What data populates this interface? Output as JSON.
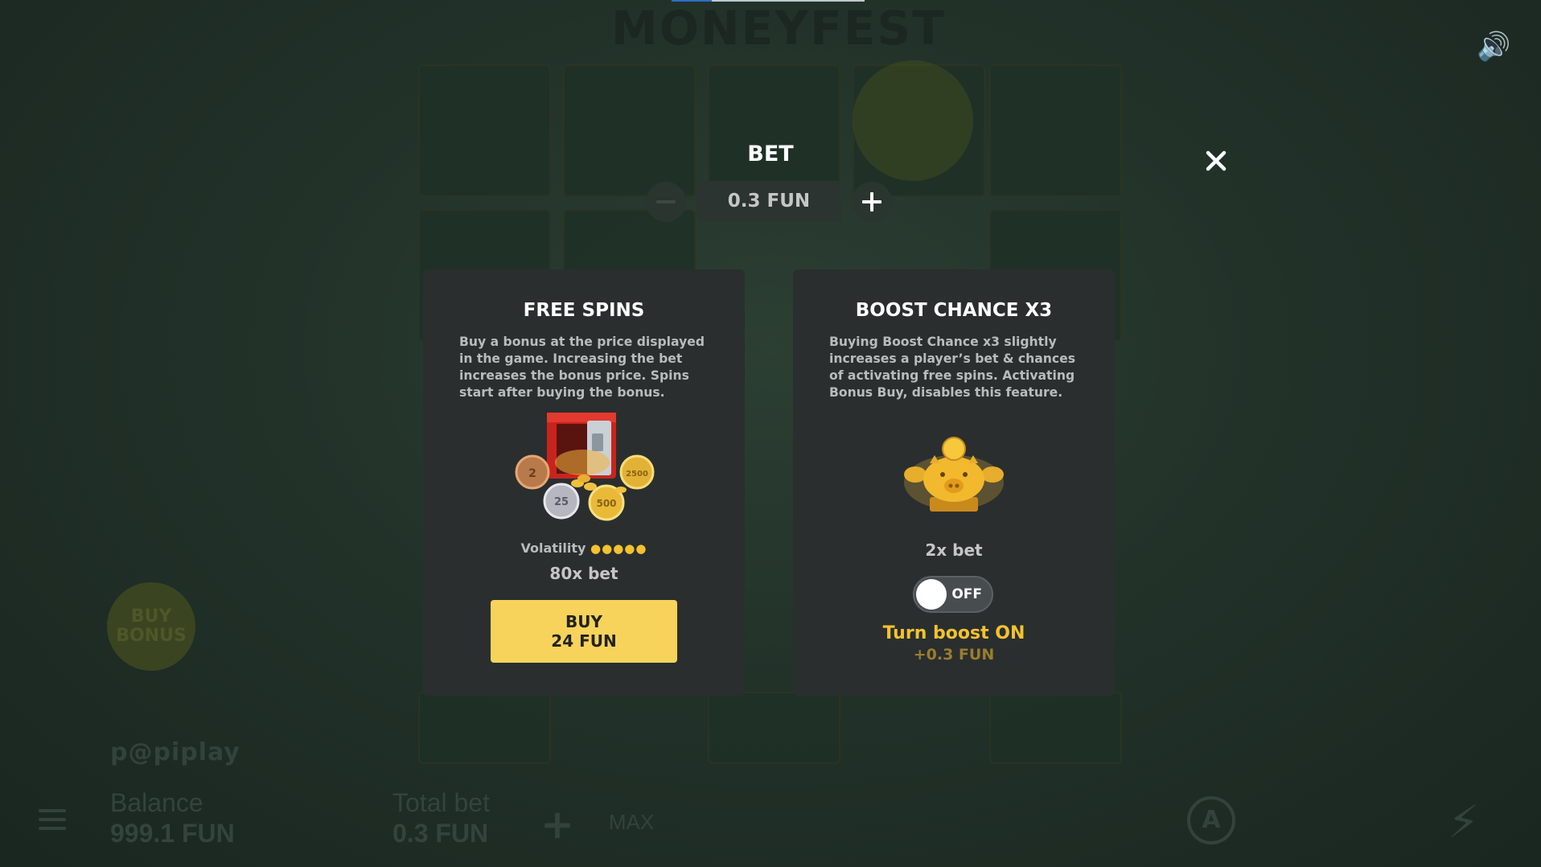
{
  "background": {
    "logo_text": "MONEYFEST",
    "buy_bonus_label": "BUY BONUS",
    "brand": "p@piplay",
    "balance_label": "Balance",
    "balance_value": "999.1 FUN",
    "total_bet_label": "Total bet",
    "total_bet_value": "0.3 FUN",
    "max_label": "MAX",
    "auto_label": "A"
  },
  "bet": {
    "title": "BET",
    "value": "0.3 FUN"
  },
  "free_spins": {
    "title": "FREE SPINS",
    "description": "Buy a bonus at the price displayed in the game. Increasing the bet increases the bonus price. Spins start after buying the bonus.",
    "volatility_label": "Volatility",
    "volatility_level": 5,
    "volatility_dots": "●●●●●",
    "multiplier": "80x bet",
    "buy_label": "BUY",
    "buy_price": "24 FUN"
  },
  "boost": {
    "title": "BOOST CHANCE X3",
    "description": "Buying Boost Chance x3 slightly increases a player’s bet & chances of activating free spins. Activating Bonus Buy, disables this feature.",
    "multiplier": "2x bet",
    "toggle_state": "OFF",
    "action_label": "Turn boost ON",
    "action_price": "+0.3 FUN"
  },
  "colors": {
    "accent_yellow": "#f7d35b",
    "gold_text": "#f2c230",
    "card_bg": "#2a2e2e"
  },
  "icons": {
    "close": "close-icon",
    "minus": "minus-icon",
    "plus": "plus-icon",
    "speaker": "speaker-icon",
    "menu": "menu-icon",
    "lightning": "lightning-icon"
  }
}
